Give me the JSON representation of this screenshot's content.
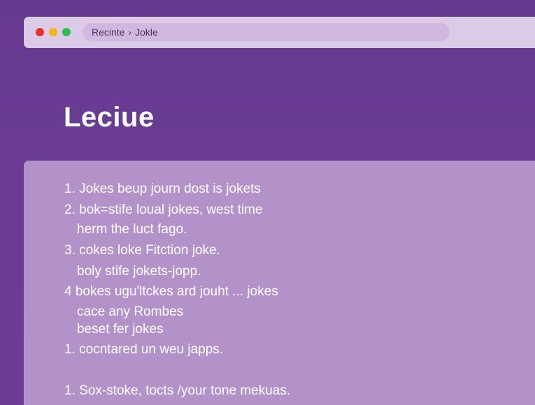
{
  "window": {
    "breadcrumb": {
      "parent": "Recinte",
      "separator": "›",
      "current": "Jokle"
    }
  },
  "page": {
    "title": "Leciue"
  },
  "list": {
    "lines": [
      "1. Jokes beup journ dost is jokets",
      "2. bok=stife loual jokes, west time",
      "herm the luct fago.",
      "3. cokes loke Fitction joke.",
      "boly stife jokets-jopp.",
      "4 bokes ugu'ltckes ard jouht ... jokes",
      "cace any Rombes",
      "beset fer jokes",
      "1. cocntared un weu japps.",
      "1. Sox-stoke, tocts /your tone mekuas."
    ]
  },
  "colors": {
    "background": "#673a91",
    "window_bar": "#dccbe7",
    "address_bar": "#cfb9de",
    "content_card": "#b392c9",
    "close_dot": "#e5322f",
    "minimize_dot": "#f2b61b",
    "maximize_dot": "#2fbc4e"
  }
}
